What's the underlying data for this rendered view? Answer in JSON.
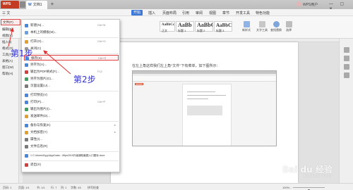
{
  "titlebar": {
    "app_tab_label": "WPS",
    "doc_tab_label": "文档1",
    "doc_tab_icon_letter": "W",
    "new_tab": "+",
    "user_name": "WPS用户",
    "window_controls": "— ▢ ✕"
  },
  "menubar": {
    "file_label": "三 文件",
    "tabs": [
      "开始",
      "插入",
      "页面布局",
      "引用",
      "审阅",
      "视图",
      "章节",
      "开发工具",
      "特色功能"
    ],
    "active_tab_index": 0
  },
  "ribbon": {
    "styles": [
      {
        "sample": "AaBbCcDd",
        "caption": "正文"
      },
      {
        "sample": "AaBb",
        "caption": "标题 1"
      },
      {
        "sample": "AaBbC",
        "caption": "标题 2"
      },
      {
        "sample": "AaBbCc",
        "caption": "标题 3"
      }
    ],
    "buttons": [
      "新样式",
      "文字工具",
      "查找替换",
      "选择"
    ]
  },
  "left_nav": {
    "items": [
      "文件(F)",
      "编辑(E)",
      "视图(V)",
      "插入(I)",
      "格式(O)",
      "工具(T)",
      "表格(A)",
      "窗口(W)",
      "帮助(H)"
    ],
    "selected_index": 0
  },
  "dropdown_menu": {
    "items": [
      {
        "label": "新建(N)...",
        "key": "Ctrl+N",
        "arrow": "",
        "color": "#4a86d8"
      },
      {
        "label": "本机上的模板(M)...",
        "key": "",
        "arrow": "",
        "color": "#6aa0e0"
      },
      {
        "label": "打开(O)...",
        "key": "Ctrl+O",
        "arrow": "",
        "color": "#e0a030"
      },
      {
        "label": "关闭(C)",
        "key": "",
        "arrow": "",
        "color": "#999999"
      },
      {
        "label": "保存(S)",
        "key": "Ctrl+S",
        "arrow": "",
        "color": "#4a86d8"
      },
      {
        "label": "另存为(A)...",
        "key": "",
        "arrow": "",
        "color": "#4a86d8"
      },
      {
        "label": "输出为PDF格式(F)...",
        "key": "F12",
        "arrow": "",
        "color": "#d04040"
      },
      {
        "label": "另存为图片(G)...",
        "key": "",
        "arrow": "",
        "color": "#40a060"
      },
      {
        "label": "页面设置(U)...",
        "key": "",
        "arrow": "",
        "color": "#7a7a7a"
      },
      {
        "label": "打印预览(V)",
        "key": "",
        "arrow": "",
        "color": "#4a86d8"
      },
      {
        "label": "打印(P)...",
        "key": "Ctrl+P",
        "arrow": "",
        "color": "#4a86d8"
      },
      {
        "label": "输出为图片(I)...",
        "key": "",
        "arrow": "",
        "color": "#40a060"
      },
      {
        "label": "发送邮件(D)...",
        "key": "",
        "arrow": "",
        "color": "#e0a030"
      },
      {
        "label": "备份与恢复(K)",
        "key": "",
        "arrow": "▸",
        "color": "#4a86d8"
      },
      {
        "label": "文档加密(Y)",
        "key": "",
        "arrow": "▸",
        "color": "#e0a030"
      },
      {
        "label": "属性(I)...",
        "key": "",
        "arrow": "",
        "color": "#7a7a7a"
      },
      {
        "label": "文件信息(R)",
        "key": "",
        "arrow": "",
        "color": "#7a7a7a"
      },
      {
        "label": "1 C:\\Users\\Kyyy\\AppData\\...\\Wps2019升级通知截图入口图标.docx",
        "key": "",
        "arrow": "",
        "color": "#4a86d8"
      },
      {
        "label": "退出(X)",
        "key": "",
        "arrow": "",
        "color": "#d04040"
      }
    ],
    "selected_index": 4
  },
  "document": {
    "paragraph": "在左上角这样我们左上角“文件”下有菜单，如下图所示："
  },
  "annotations": {
    "step1": "第1步",
    "step2": "第2步"
  },
  "statusbar": {
    "items": [
      "页码: 1",
      "页面: 1/1",
      "节: 1/1",
      "行: 7",
      "列: 1",
      "字数: 45",
      "拼写检查"
    ],
    "zoom": "100% -",
    "zoom_level": 0.5
  },
  "watermark": {
    "text": "Bai du 经验",
    "sub": "jingyan.baidu.com"
  },
  "colors": {
    "accent": "#3c78d8",
    "highlight": "#d94848",
    "annotation": "#2f2fdd",
    "app_tab": "#c23b22"
  }
}
